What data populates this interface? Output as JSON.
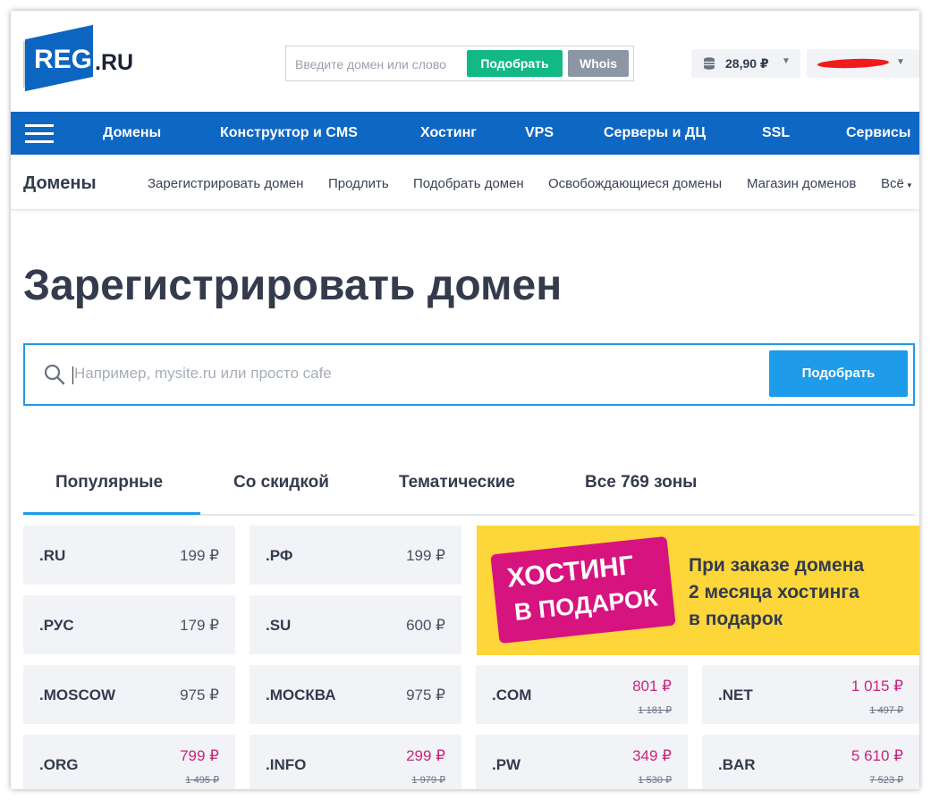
{
  "header": {
    "logo_main": "REG",
    "logo_suffix": ".RU",
    "search_placeholder": "Введите домен или слово",
    "pick_label": "Подобрать",
    "whois_label": "Whois",
    "balance": "28,90 ₽"
  },
  "nav": {
    "items": [
      "Домены",
      "Конструктор и CMS",
      "Хостинг",
      "VPS",
      "Серверы и ДЦ",
      "SSL",
      "Сервисы"
    ]
  },
  "subnav": {
    "title": "Домены",
    "links": [
      "Зарегистрировать домен",
      "Продлить",
      "Подобрать домен",
      "Освобождающиеся домены",
      "Магазин доменов",
      "Всё"
    ]
  },
  "main": {
    "title": "Зарегистрировать домен",
    "search_placeholder": "Например, mysite.ru или просто cafe",
    "search_button": "Подобрать",
    "tabs": [
      "Популярные",
      "Со скидкой",
      "Тематические",
      "Все 769 зоны"
    ],
    "active_tab": 0
  },
  "domains": [
    {
      "zone": ".RU",
      "price": "199 ₽"
    },
    {
      "zone": ".РФ",
      "price": "199 ₽"
    },
    {
      "zone": ".РУС",
      "price": "179 ₽"
    },
    {
      "zone": ".SU",
      "price": "600 ₽"
    },
    {
      "zone": ".MOSCOW",
      "price": "975 ₽"
    },
    {
      "zone": ".МОСКВА",
      "price": "975 ₽"
    },
    {
      "zone": ".COM",
      "price": "801 ₽",
      "old": "1 181 ₽"
    },
    {
      "zone": ".NET",
      "price": "1 015 ₽",
      "old": "1 497 ₽"
    },
    {
      "zone": ".ORG",
      "price": "799 ₽",
      "old": "1 495 ₽"
    },
    {
      "zone": ".INFO",
      "price": "299 ₽",
      "old": "1 979 ₽"
    },
    {
      "zone": ".PW",
      "price": "349 ₽",
      "old": "1 530 ₽"
    },
    {
      "zone": ".BAR",
      "price": "5 610 ₽",
      "old": "7 523 ₽"
    }
  ],
  "banner": {
    "badge_line1": "ХОСТИНГ",
    "badge_line2": "В ПОДАРОК",
    "text_line1": "При заказе домена",
    "text_line2": "2 месяца хостинга",
    "text_line3": "в подарок"
  },
  "colors": {
    "brand_blue": "#0e67c3",
    "accent_blue": "#1e9be9",
    "green": "#12b886",
    "sale_pink": "#c8257d",
    "banner_yellow": "#fdd63a",
    "badge_magenta": "#d6137f"
  }
}
